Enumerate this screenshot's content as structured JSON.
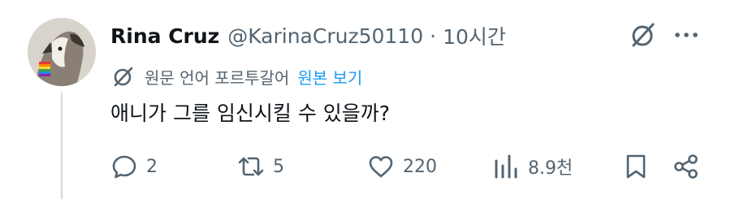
{
  "tweet": {
    "author_name": "Rina Cruz",
    "handle": "@KarinaCruz50110",
    "separator": "·",
    "time": "10시간",
    "translation_note": "원문 언어 포르투갈어",
    "show_original": "원본 보기",
    "text": "애니가 그를 임신시킬 수 있을까?"
  },
  "actions": {
    "replies": "2",
    "reposts": "5",
    "likes": "220",
    "views": "8.9천"
  },
  "colors": {
    "primary_text": "#0f1419",
    "secondary_text": "#536471",
    "link": "#1d9bf0",
    "thread_line": "#cfd9de"
  },
  "icons": [
    "grok-icon",
    "more-icon",
    "translate-icon",
    "reply-icon",
    "repost-icon",
    "like-icon",
    "views-icon",
    "bookmark-icon",
    "share-icon"
  ]
}
